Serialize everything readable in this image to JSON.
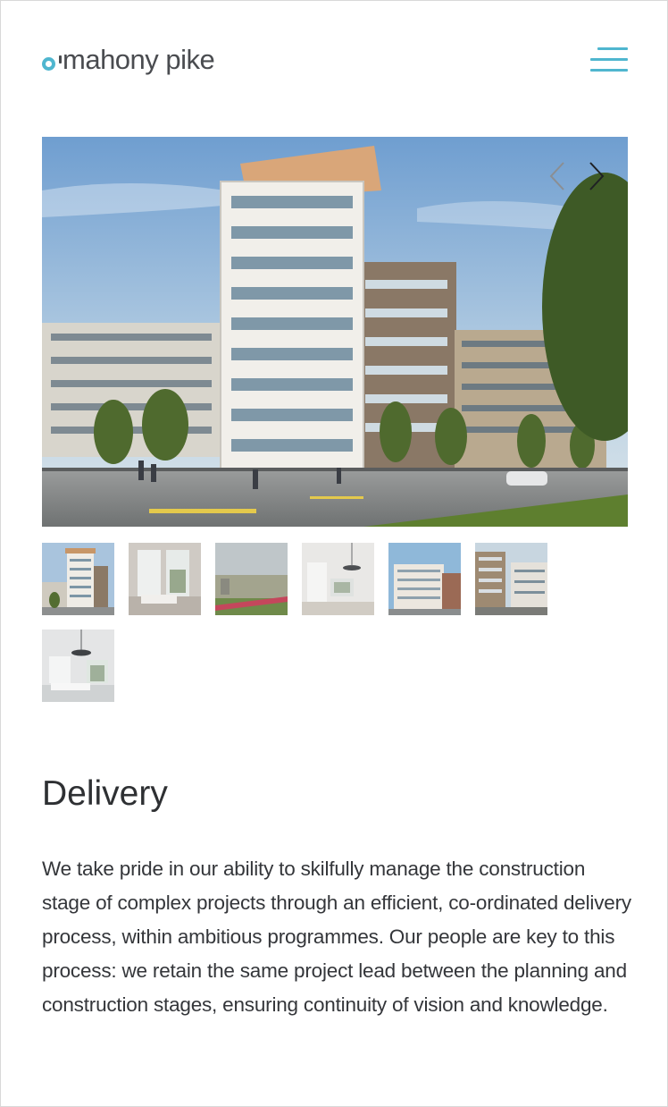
{
  "header": {
    "logo_text": "mahony pike",
    "logo_alt": "o'mahony pike",
    "menu_icon": "hamburger-menu-icon",
    "accent_color": "#4fb6cf"
  },
  "gallery": {
    "prev_icon": "chevron-left-icon",
    "next_icon": "chevron-right-icon",
    "thumbnails": [
      {
        "name": "thumb-tower-exterior"
      },
      {
        "name": "thumb-living-room"
      },
      {
        "name": "thumb-aerial-view"
      },
      {
        "name": "thumb-kitchen-interior"
      },
      {
        "name": "thumb-blue-facade"
      },
      {
        "name": "thumb-courtyard"
      },
      {
        "name": "thumb-bedroom"
      }
    ]
  },
  "content": {
    "title": "Delivery",
    "body": "We take pride in our ability to skilfully manage the construction stage of complex projects through an efficient, co-ordinated delivery process, within ambitious programmes. Our people are key to this process: we retain the same project lead between the planning and construction stages, ensuring continuity of vision and knowledge."
  }
}
